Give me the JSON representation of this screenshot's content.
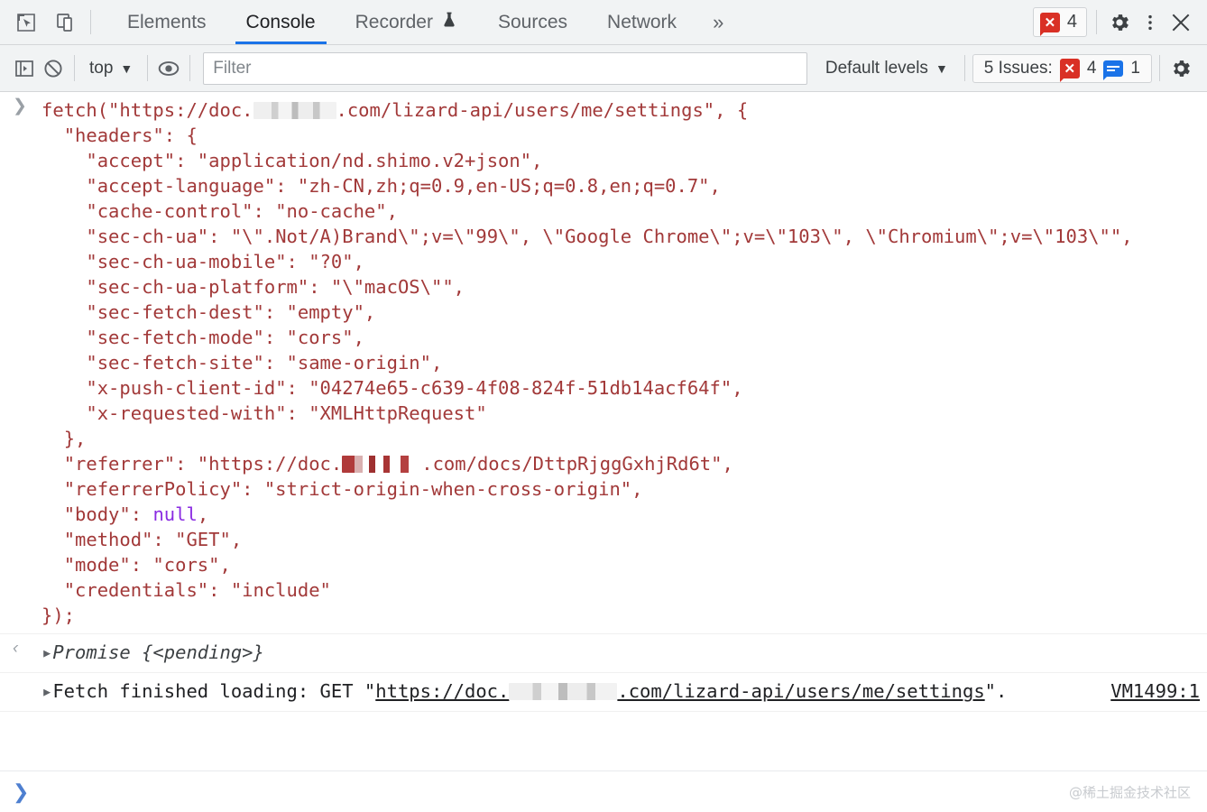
{
  "devtools": {
    "tabs": [
      {
        "id": "elements",
        "label": "Elements",
        "active": false,
        "icon": null
      },
      {
        "id": "console",
        "label": "Console",
        "active": true,
        "icon": null
      },
      {
        "id": "recorder",
        "label": "Recorder",
        "active": false,
        "icon": "flask-icon"
      },
      {
        "id": "sources",
        "label": "Sources",
        "active": false,
        "icon": null
      },
      {
        "id": "network",
        "label": "Network",
        "active": false,
        "icon": null
      }
    ],
    "more_tabs_label": "»",
    "inspect_icon": "cursor-inspect-icon",
    "device_toolbar_icon": "device-toggle-icon",
    "error_chip": {
      "count": "4",
      "icon": "error-badge-icon"
    },
    "settings_icon": "gear-icon",
    "more_options_icon": "kebab-menu-icon",
    "close_icon": "close-icon"
  },
  "toolbar": {
    "sidebar_icon": "console-sidebar-icon",
    "clear_icon": "clear-console-icon",
    "context_label": "top",
    "context_caret": "▼",
    "eye_icon": "live-expression-icon",
    "filter_placeholder": "Filter",
    "filter_value": "",
    "levels_label": "Default levels",
    "levels_caret": "▼",
    "issues": {
      "label": "5 Issues:",
      "error_count": "4",
      "info_count": "1",
      "error_icon": "error-badge-icon",
      "info_icon": "info-badge-icon"
    },
    "settings_icon": "gear-icon"
  },
  "console": {
    "input_gutter": "❯",
    "output_gutter": "‹",
    "input_lines": [
      "fetch(\"https://doc.██.com/lizard-api/users/me/settings\", {",
      "  \"headers\": {",
      "    \"accept\": \"application/nd.shimo.v2+json\",",
      "    \"accept-language\": \"zh-CN,zh;q=0.9,en-US;q=0.8,en;q=0.7\",",
      "    \"cache-control\": \"no-cache\",",
      "    \"sec-ch-ua\": \"\\\".Not/A)Brand\\\";v=\\\"99\\\", \\\"Google Chrome\\\";v=\\\"103\\\", \\\"Chromium\\\";v=\\\"103\\\"\",",
      "    \"sec-ch-ua-mobile\": \"?0\",",
      "    \"sec-ch-ua-platform\": \"\\\"macOS\\\"\",",
      "    \"sec-fetch-dest\": \"empty\",",
      "    \"sec-fetch-mode\": \"cors\",",
      "    \"sec-fetch-site\": \"same-origin\",",
      "    \"x-push-client-id\": \"04274e65-c639-4f08-824f-51db14acf64f\",",
      "    \"x-requested-with\": \"XMLHttpRequest\"",
      "  },",
      "  \"referrer\": \"https://doc.██.com/docs/DttpRjggGxhjRd6t\",",
      "  \"referrerPolicy\": \"strict-origin-when-cross-origin\",",
      "  \"body\": null,",
      "  \"method\": \"GET\",",
      "  \"mode\": \"cors\",",
      "  \"credentials\": \"include\"",
      "});"
    ],
    "code": {
      "l1_a": "fetch(\"https://doc.",
      "l1_b": ".com/lizard-api/users/me/settings\", {",
      "l2": "  \"headers\": {",
      "l3": "    \"accept\": \"application/nd.shimo.v2+json\",",
      "l4": "    \"accept-language\": \"zh-CN,zh;q=0.9,en-US;q=0.8,en;q=0.7\",",
      "l5": "    \"cache-control\": \"no-cache\",",
      "l6": "    \"sec-ch-ua\": \"\\\".Not/A)Brand\\\";v=\\\"99\\\", \\\"Google Chrome\\\";v=\\\"103\\\", \\\"Chromium\\\";v=\\\"103\\\"\",",
      "l7": "    \"sec-ch-ua-mobile\": \"?0\",",
      "l8": "    \"sec-ch-ua-platform\": \"\\\"macOS\\\"\",",
      "l9": "    \"sec-fetch-dest\": \"empty\",",
      "l10": "    \"sec-fetch-mode\": \"cors\",",
      "l11": "    \"sec-fetch-site\": \"same-origin\",",
      "l12": "    \"x-push-client-id\": \"04274e65-c639-4f08-824f-51db14acf64f\",",
      "l13": "    \"x-requested-with\": \"XMLHttpRequest\"",
      "l14": "  },",
      "l15_a": "  \"referrer\": \"https://doc.",
      "l15_b": ".com/docs/DttpRjggGxhjRd6t\",",
      "l16": "  \"referrerPolicy\": \"strict-origin-when-cross-origin\",",
      "l17_a": "  \"body\": ",
      "l17_null": "null",
      "l17_b": ",",
      "l18": "  \"method\": \"GET\",",
      "l19": "  \"mode\": \"cors\",",
      "l20": "  \"credentials\": \"include\"",
      "l21": "});"
    },
    "result": {
      "disclosure": "▸",
      "text": "Promise {<pending>}"
    },
    "log": {
      "disclosure": "▸",
      "prefix": "Fetch finished loading: GET \"",
      "link_a": "https://doc.",
      "link_b": ".com/lizard-api/users/me/settings",
      "suffix": "\".",
      "source": "VM1499:1"
    }
  },
  "prompt": {
    "carat": "❯",
    "value": "",
    "watermark": "@稀土掘金技术社区"
  },
  "colors": {
    "accent": "#1a73e8",
    "error": "#d93025",
    "code_text": "#a23939",
    "chrome_bg": "#f1f3f4",
    "keyword": "#8a2be2"
  }
}
